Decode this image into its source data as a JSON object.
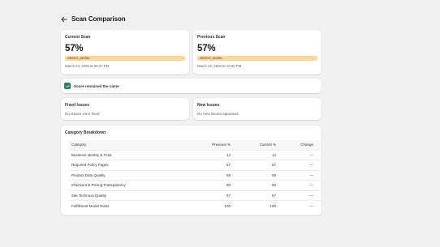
{
  "header": {
    "back_icon": "arrow-left-icon",
    "title": "Scan Comparison"
  },
  "current_scan": {
    "title": "Current Scan",
    "score": "57%",
    "badge": "NEEDS_WORK",
    "date": "March 23, 2026 at 08:37 PM"
  },
  "previous_scan": {
    "title": "Previous Scan",
    "score": "57%",
    "badge": "NEEDS_WORK",
    "date": "March 12, 2026 at 10:46 PM"
  },
  "status": {
    "icon": "checkmark-icon",
    "text": "Score remained the same",
    "color": "#29845a"
  },
  "fixed_issues": {
    "title": "Fixed Issues",
    "empty_text": "No issues were fixed"
  },
  "new_issues": {
    "title": "New Issues",
    "empty_text": "No new issues appeared"
  },
  "breakdown": {
    "title": "Category Breakdown",
    "columns": [
      "Category",
      "Previous %",
      "Current %",
      "Change"
    ],
    "rows": [
      {
        "category": "Business Identity & Trust",
        "previous": "14",
        "current": "14",
        "change": "—"
      },
      {
        "category": "Required Policy Pages",
        "previous": "67",
        "current": "67",
        "change": "—"
      },
      {
        "category": "Product Data Quality",
        "previous": "59",
        "current": "59",
        "change": "—"
      },
      {
        "category": "Checkout & Pricing Transparency",
        "previous": "60",
        "current": "60",
        "change": "—"
      },
      {
        "category": "Site Technical Quality",
        "previous": "67",
        "current": "67",
        "change": "—"
      },
      {
        "category": "Fulfillment Model Risks",
        "previous": "100",
        "current": "100",
        "change": "—"
      }
    ]
  },
  "colors": {
    "badge_bg": "#ffd79d",
    "page_bg": "#f1f1f1"
  }
}
